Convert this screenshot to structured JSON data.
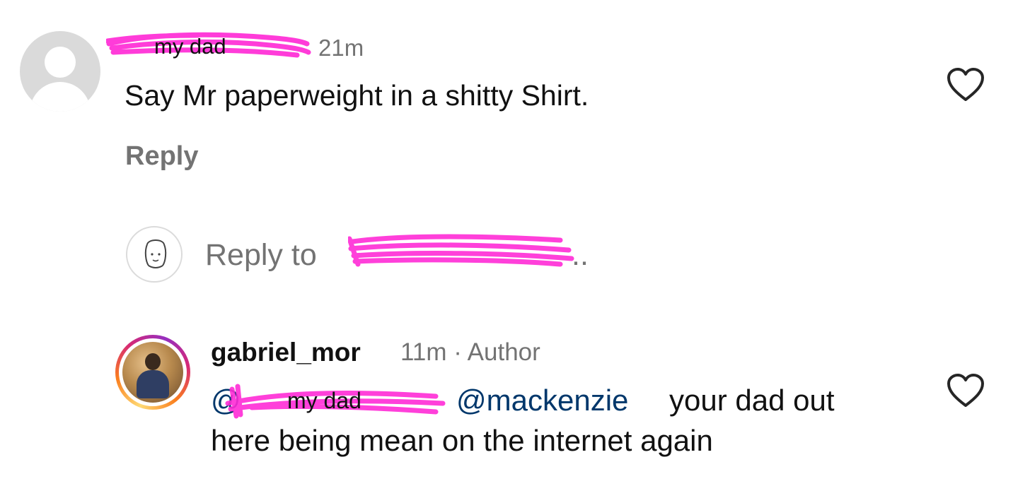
{
  "comment1": {
    "username_redaction_label": "my dad",
    "time": "21m",
    "text": "Say Mr paperweight in a shitty Shirt.",
    "reply_label": "Reply",
    "like_icon": "heart-outline-icon"
  },
  "composer": {
    "placeholder": "Reply to",
    "truncation": "..",
    "avatar_icon": "face-sketch-icon"
  },
  "comment2": {
    "username": "gabriel_mor",
    "meta": "11m · Author",
    "mention_prefix": "@",
    "mention_redaction_label": "my dad",
    "mention2": "@mackenzie",
    "text_line1": "your dad out",
    "text_line2": "here being mean on the internet again",
    "like_icon": "heart-outline-icon"
  },
  "colors": {
    "redaction": "#ff2bd6",
    "mention": "#00376b",
    "secondary_text": "#737373",
    "story_ring": [
      "#feda75",
      "#fa7e1e",
      "#d62976",
      "#962fbf"
    ]
  }
}
